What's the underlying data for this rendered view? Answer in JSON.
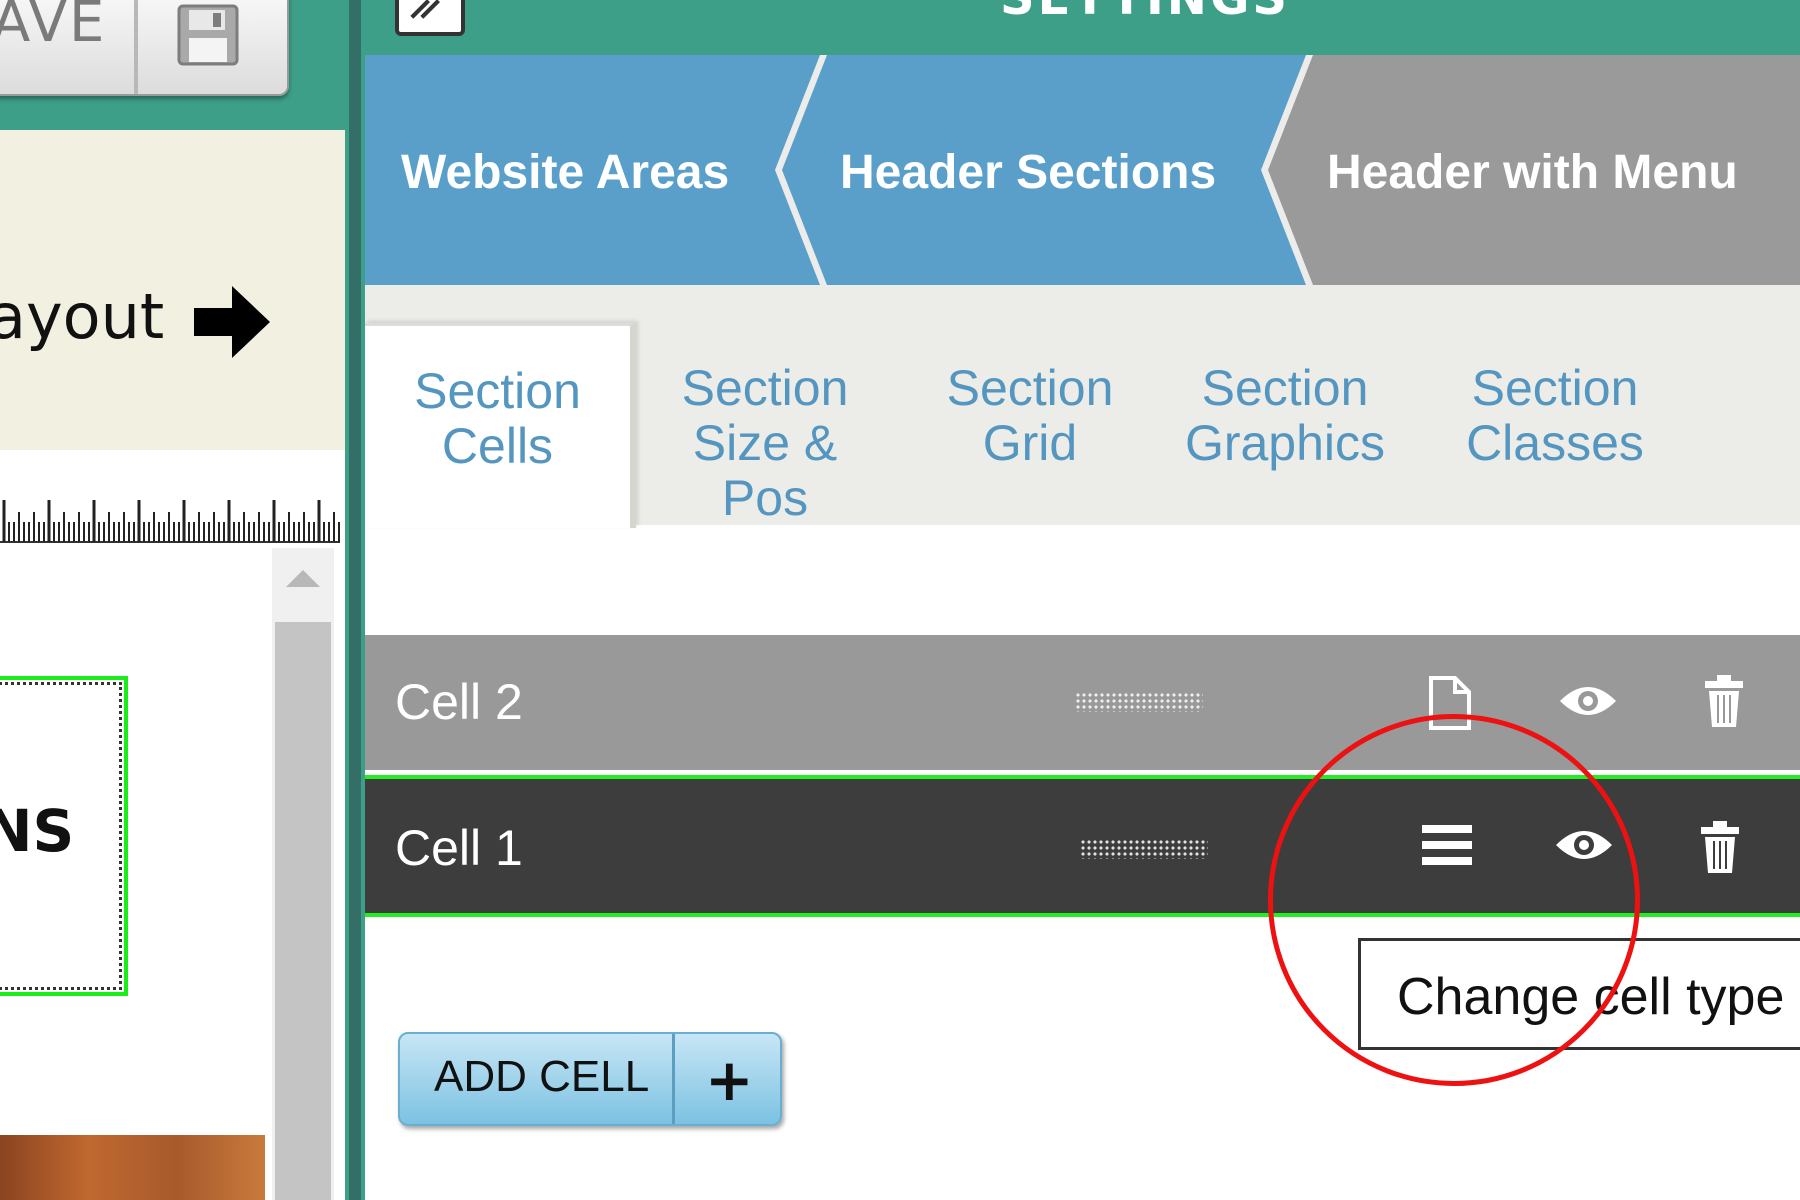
{
  "toolbar": {
    "save_label": "AVE",
    "save_icon": "floppy-disk-icon"
  },
  "left_pane": {
    "instruction_text": "ayout",
    "arrow_icon": "arrow-right-icon",
    "element_text": "NS"
  },
  "panel": {
    "title": "SETTINGS",
    "edit_icon": "edit-icon"
  },
  "breadcrumb": {
    "items": [
      {
        "label": "Website Areas",
        "color": "#5a9fca"
      },
      {
        "label": "Header Sections",
        "color": "#5a9fca"
      },
      {
        "label": "Header with Menu",
        "color": "#9a9a9a"
      }
    ]
  },
  "tabs": [
    {
      "line1": "Section",
      "line2": "Cells",
      "active": true
    },
    {
      "line1": "Section",
      "line2": "Size & Pos",
      "active": false
    },
    {
      "line1": "Section",
      "line2": "Grid",
      "active": false
    },
    {
      "line1": "Section",
      "line2": "Graphics",
      "active": false
    },
    {
      "line1": "Section",
      "line2": "Classes",
      "active": false
    }
  ],
  "cells": [
    {
      "label": "Cell 2",
      "type_icon": "page-icon",
      "visibility_icon": "eye-icon",
      "delete_icon": "trash-icon",
      "selected": false
    },
    {
      "label": "Cell 1",
      "type_icon": "menu-icon",
      "visibility_icon": "eye-icon",
      "delete_icon": "trash-icon",
      "selected": true
    }
  ],
  "tooltip": {
    "text": "Change cell type"
  },
  "add_cell": {
    "label": "ADD CELL",
    "icon": "plus-icon"
  },
  "colors": {
    "teal": "#3d9f88",
    "breadcrumb_blue": "#5a9fca",
    "breadcrumb_gray": "#9a9a9a",
    "selected_outline": "#22ee22",
    "annotation_red": "#ee1111",
    "tab_text": "#5596c0"
  }
}
